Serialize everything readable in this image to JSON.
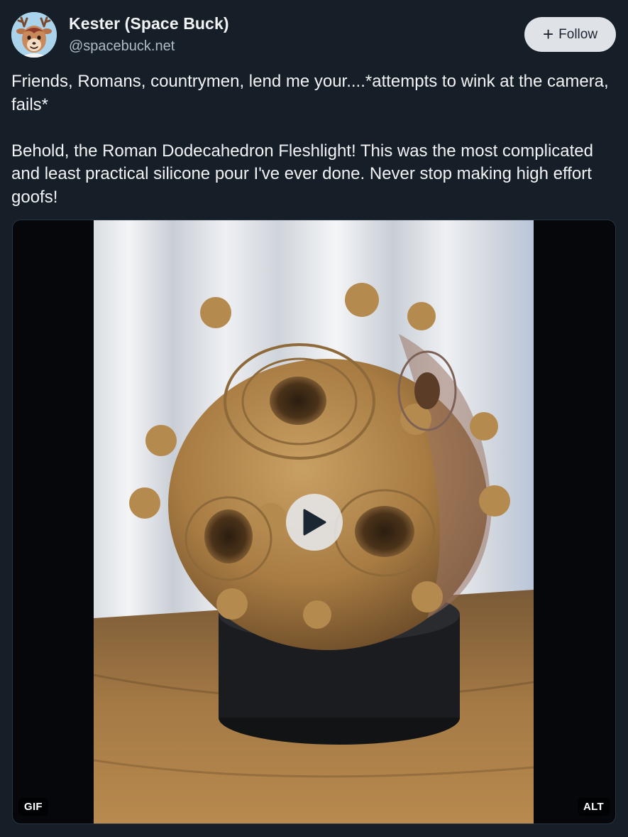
{
  "author": {
    "display_name": "Kester (Space Buck)",
    "handle": "@spacebuck.net",
    "avatar_icon": "deer-avatar"
  },
  "follow_button": {
    "icon": "plus-icon",
    "label": "Follow"
  },
  "post": {
    "paragraphs": [
      "Friends, Romans, countrymen, lend me your....*attempts to wink at the camera, fails*",
      "Behold, the Roman Dodecahedron Fleshlight! This was the most complicated and least practical silicone pour I've ever done. Never stop making high effort goofs!"
    ]
  },
  "media": {
    "type": "video",
    "play_icon": "play-icon",
    "gif_badge": "GIF",
    "alt_badge": "ALT"
  },
  "colors": {
    "background": "#161e27",
    "text": "#f1f3f5",
    "handle": "#aebbc9",
    "follow_bg": "#dfe3e8",
    "follow_text": "#1b2430"
  }
}
